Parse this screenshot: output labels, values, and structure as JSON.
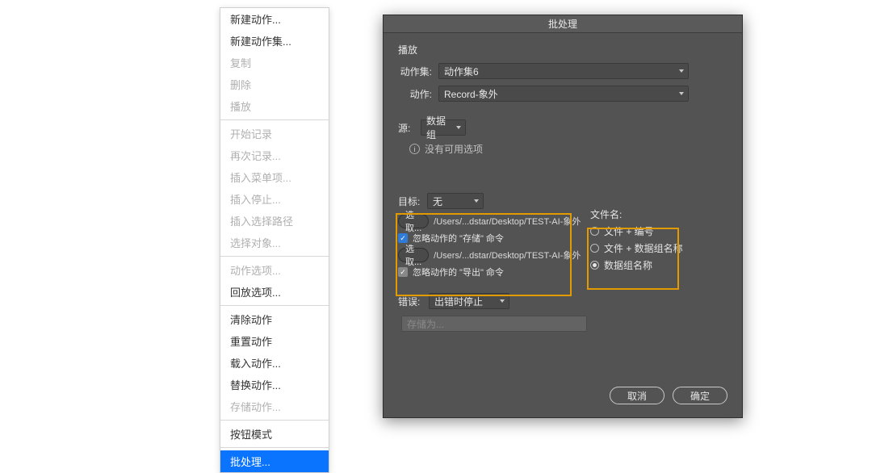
{
  "context_menu": {
    "groups": [
      [
        {
          "label": "新建动作...",
          "disabled": false
        },
        {
          "label": "新建动作集...",
          "disabled": false
        },
        {
          "label": "复制",
          "disabled": true
        },
        {
          "label": "删除",
          "disabled": true
        },
        {
          "label": "播放",
          "disabled": true
        }
      ],
      [
        {
          "label": "开始记录",
          "disabled": true
        },
        {
          "label": "再次记录...",
          "disabled": true
        },
        {
          "label": "插入菜单项...",
          "disabled": true
        },
        {
          "label": "插入停止...",
          "disabled": true
        },
        {
          "label": "插入选择路径",
          "disabled": true
        },
        {
          "label": "选择对象...",
          "disabled": true
        }
      ],
      [
        {
          "label": "动作选项...",
          "disabled": true
        },
        {
          "label": "回放选项...",
          "disabled": false
        }
      ],
      [
        {
          "label": "清除动作",
          "disabled": false
        },
        {
          "label": "重置动作",
          "disabled": false
        },
        {
          "label": "载入动作...",
          "disabled": false
        },
        {
          "label": "替换动作...",
          "disabled": false
        },
        {
          "label": "存储动作...",
          "disabled": true
        }
      ],
      [
        {
          "label": "按钮模式",
          "disabled": false
        }
      ],
      [
        {
          "label": "批处理...",
          "disabled": false,
          "selected": true
        }
      ]
    ]
  },
  "dialog": {
    "title": "批处理",
    "play_section": "播放",
    "action_set_label": "动作集:",
    "action_set_value": "动作集6",
    "action_label": "动作:",
    "action_value": "Record-象外",
    "source_label": "源:",
    "source_value": "数据组",
    "no_options": "没有可用选项",
    "dest_label": "目标:",
    "dest_value": "无",
    "choose1_btn": "选取...",
    "path1": "/Users/...dstar/Desktop/TEST-AI-象外",
    "override_save": "忽略动作的 \"存储\" 命令",
    "choose2_btn": "选取...",
    "path2": "/Users/...dstar/Desktop/TEST-AI-象外",
    "override_export": "忽略动作的 \"导出\" 命令",
    "filename_label": "文件名:",
    "radio1": "文件 + 编号",
    "radio2": "文件 + 数据组名称",
    "radio3": "数据组名称",
    "error_label": "错误:",
    "error_value": "出错时停止",
    "save_as_placeholder": "存储为...",
    "cancel": "取消",
    "ok": "确定"
  }
}
